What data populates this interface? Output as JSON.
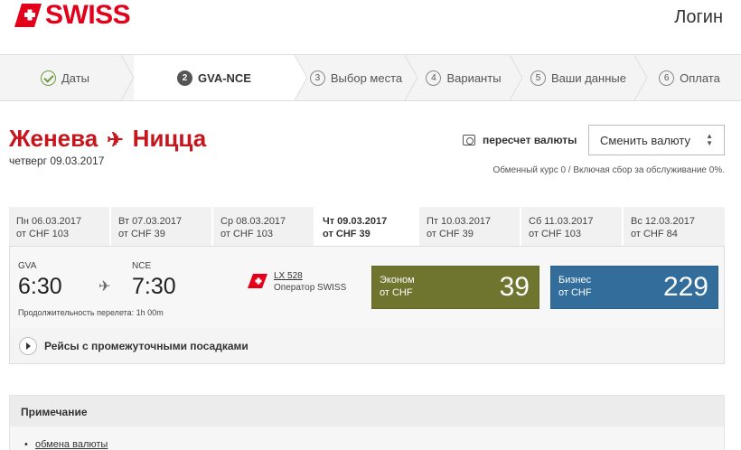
{
  "header": {
    "brand": "SWISS",
    "login": "Логин"
  },
  "steps": [
    {
      "label": "Даты",
      "state": "done"
    },
    {
      "label": "GVA-NCE",
      "num": "2",
      "state": "active"
    },
    {
      "label": "Выбор места",
      "num": "3"
    },
    {
      "label": "Варианты",
      "num": "4"
    },
    {
      "label": "Ваши данные",
      "num": "5"
    },
    {
      "label": "Оплата",
      "num": "6"
    }
  ],
  "route": {
    "from": "Женева",
    "to": "Ницца",
    "date": "четверг 09.03.2017"
  },
  "currency": {
    "convert_label": "пересчет валюты",
    "select_label": "Сменить валюту",
    "rate_note": "Обменный курс 0 / Включая сбор за обслуживание 0%."
  },
  "dates": [
    {
      "day": "Пн 06.03.2017",
      "price": "от CHF 103"
    },
    {
      "day": "Вт 07.03.2017",
      "price": "от CHF 39"
    },
    {
      "day": "Ср 08.03.2017",
      "price": "от CHF 103"
    },
    {
      "day": "Чт 09.03.2017",
      "price": "от CHF 39",
      "active": true
    },
    {
      "day": "Пт 10.03.2017",
      "price": "от CHF 39"
    },
    {
      "day": "Сб 11.03.2017",
      "price": "от CHF 103"
    },
    {
      "day": "Вс 12.03.2017",
      "price": "от CHF 84"
    }
  ],
  "flight": {
    "dep_code": "GVA",
    "dep_time": "6:30",
    "arr_code": "NCE",
    "arr_time": "7:30",
    "duration": "Продолжительность перелета: 1h 00m",
    "number": "LX 528",
    "operator": "Оператор SWISS",
    "economy": {
      "label": "Эконом",
      "from": "от CHF",
      "price": "39"
    },
    "business": {
      "label": "Бизнес",
      "from": "от CHF",
      "price": "229"
    },
    "connections": "Рейсы с промежуточными посадками"
  },
  "note": {
    "title": "Примечание",
    "link": "обмена валюты"
  },
  "colors": {
    "brand_red": "#e2001a",
    "route_red": "#c4161c",
    "economy": "#6f742e",
    "business": "#326d9b"
  }
}
